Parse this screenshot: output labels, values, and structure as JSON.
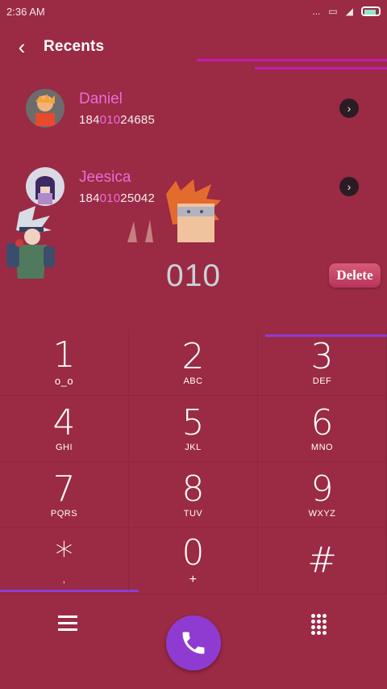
{
  "status": {
    "time": "2:36 AM",
    "dots": "..."
  },
  "header": {
    "title": "Recents",
    "back_icon": "back-arrow-icon"
  },
  "recents": [
    {
      "name": "Daniel",
      "number_parts": [
        "184",
        "010",
        "24685"
      ]
    },
    {
      "name": "Jeesica",
      "number_parts": [
        "184",
        "010",
        "25042"
      ]
    }
  ],
  "dial": {
    "digits": "010",
    "delete_label": "Delete"
  },
  "keypad": [
    {
      "num": "1",
      "sub": ""
    },
    {
      "num": "2",
      "sub": "ABC"
    },
    {
      "num": "3",
      "sub": "DEF"
    },
    {
      "num": "4",
      "sub": "GHI"
    },
    {
      "num": "5",
      "sub": "JKL"
    },
    {
      "num": "6",
      "sub": "MNO"
    },
    {
      "num": "7",
      "sub": "PQRS"
    },
    {
      "num": "8",
      "sub": "TUV"
    },
    {
      "num": "9",
      "sub": "WXYZ"
    },
    {
      "num": "*",
      "sub": ","
    },
    {
      "num": "0",
      "sub": "+"
    },
    {
      "num": "#",
      "sub": ""
    }
  ],
  "colors": {
    "background": "#9b2a44",
    "accent": "#c61bb7",
    "call": "#8f3bd2",
    "name": "#ea6bd7"
  }
}
